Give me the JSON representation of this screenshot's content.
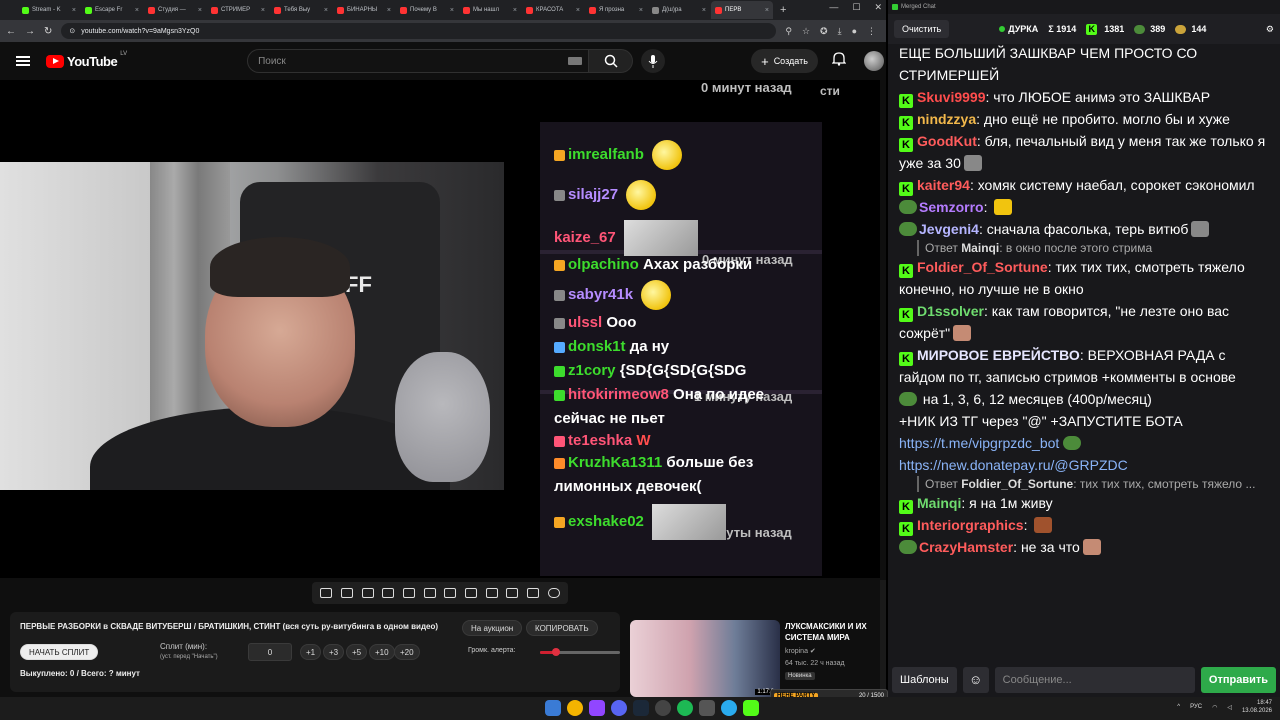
{
  "browser": {
    "tabs": [
      {
        "label": "Stream - K",
        "color": "#53fc18"
      },
      {
        "label": "Escape Fr",
        "color": "#53fc18"
      },
      {
        "label": "Студия —",
        "color": "#ff3333"
      },
      {
        "label": "СТРИМЕР",
        "color": "#ff3333"
      },
      {
        "label": "Тебя Выу",
        "color": "#ff3333"
      },
      {
        "label": "БИНАРНЫ",
        "color": "#ff3333"
      },
      {
        "label": "Почему В",
        "color": "#ff3333"
      },
      {
        "label": "Мы нашл",
        "color": "#ff3333"
      },
      {
        "label": "КРАСОТА",
        "color": "#ff3333"
      },
      {
        "label": "Я прозна",
        "color": "#ff3333"
      },
      {
        "label": "Д(ш)ра",
        "color": "#888888"
      },
      {
        "label": "ПЕРВ",
        "color": "#ff3333",
        "active": true
      }
    ],
    "url": "youtube.com/watch?v=9aMgsn3YzQ0"
  },
  "youtube": {
    "logo_text": "YouTube",
    "country": "LV",
    "search_placeholder": "Поиск",
    "create_label": "Создать"
  },
  "overlay": {
    "top_time": "0 минут назад",
    "top_fragment": "сти",
    "messages": [
      {
        "user": "imrealfanb",
        "text": ""
      },
      {
        "user": "silajj27",
        "text": ""
      },
      {
        "user": "kaize_67",
        "text": ""
      },
      {
        "user": "olpachino",
        "text": "Ахах разборки"
      },
      {
        "user": "sabyr41k",
        "text": ""
      },
      {
        "user": "ulssl",
        "text": "Ооо"
      },
      {
        "user": "donsk1t",
        "text": "да ну"
      },
      {
        "user": "z1cory",
        "text": "{SD{G{SD{G{SDG"
      },
      {
        "user": "hitokirimeow8",
        "text": "Она по идее"
      },
      {
        "user": "",
        "text": "сейчас не пьет"
      },
      {
        "user": "te1eshka",
        "text": "W"
      },
      {
        "user": "KruzhKa1311",
        "text": "больше без"
      },
      {
        "user": "",
        "text": "лимонных девочек("
      },
      {
        "user": "exshake02",
        "text": ""
      }
    ],
    "time_mid": "0 минут назад",
    "time_1m": "1 минуту назад",
    "time_2m": "2 минуты назад",
    "cam_text": "FF"
  },
  "split": {
    "title": "ПЕРВЫЕ РАЗБОРКИ в СКВАДЕ ВИТУБЕРШ / БРАТИШКИН, СТИНТ (вся суть ру-витубинга в одном видео)",
    "auction_label": "На аукцион",
    "copy_label": "КОПИРОВАТЬ",
    "start_label": "НАЧАТЬ СПЛИТ",
    "split_min_label": "Сплит (мин):",
    "split_hint": "(уст. перед \"Начать\")",
    "split_value": "0",
    "increments": [
      "+1",
      "+3",
      "+5",
      "+10",
      "+20"
    ],
    "volume_label": "Громк. алерта:",
    "volume_level": 0.2,
    "stats": "Выкуплено: 0 / Всего: ? минут"
  },
  "recommendation": {
    "title": "ЛУКСМАКСИКИ И ИХ СИСТЕМА МИРА",
    "channel": "kropina",
    "meta": "64 тыс.  22 ч назад",
    "badge": "Новинка",
    "duration": "1:17:2"
  },
  "chat": {
    "window_title": "Merged Chat",
    "clear_label": "Очистить",
    "channel": "ДУРКА",
    "stat_total": "Σ 1914",
    "stat_kick": "1381",
    "stat_twitch": "389",
    "stat_yt": "144",
    "intro": "ЕЩЕ БОЛЬШИЙ ЗАШКВАР ЧЕМ ПРОСТО СО СТРИМЕРШЕЙ",
    "messages": [
      {
        "user": "Skuvi9999",
        "color": "#ff4d4d",
        "text": "что ЛЮБОЕ анимэ это ЗАШКВАР",
        "src": "kick"
      },
      {
        "user": "nindzzya",
        "color": "#f2b84b",
        "text": "дно ещё не пробито. могло бы и хуже",
        "src": "kick"
      },
      {
        "user": "GoodKut",
        "color": "#ff5c5c",
        "text": "бля, печальный вид у меня так же только я уже за 30",
        "src": "kick"
      },
      {
        "user": "kaiter94",
        "color": "#ff5c5c",
        "text": "хомяк систему наебал, сорокет сэкономил",
        "src": "kick"
      },
      {
        "user": "Semzorro",
        "color": "#b57cff",
        "text": "",
        "src": "pepe"
      },
      {
        "user": "Jevgeni4",
        "color": "#b5b5ff",
        "text": "сначала фасолька, терь витюб",
        "src": "pepe"
      },
      {
        "user": "Foldier_Of_Sortune",
        "color": "#ff5c5c",
        "text": "тих тих тих, смотреть тяжело конечно, но лучше не в окно",
        "src": "kick"
      },
      {
        "user": "D1ssolver",
        "color": "#6fdc6f",
        "text": "как там говорится, \"не лезте оно вас сожрёт\"",
        "src": "kick"
      },
      {
        "user": "МИРОВОЕ ЕВРЕЙСТВО",
        "color": "#e6e6ff",
        "text": "ВЕРХОВНАЯ РАДА с гайдом по тг, записью стримов +комменты в основе",
        "src": "kick"
      },
      {
        "user": "Mainqi",
        "color": "#6fdc6f",
        "text": "я на 1м живу",
        "src": "kick"
      },
      {
        "user": "Interiorgraphics",
        "color": "#ff5c5c",
        "text": "",
        "src": "kick"
      },
      {
        "user": "CrazyHamster",
        "color": "#ff5c5c",
        "text": "не за что",
        "src": "pepe"
      }
    ],
    "reply1_prefix": "Ответ",
    "reply1_user": "Mainqi",
    "reply1_text": "в окно после этого стрима",
    "promo_cont1": "на 1, 3, 6, 12 месяцев (400р/месяц)",
    "promo_cont2": "+НИК ИЗ ТГ через \"@\" +ЗАПУСТИТЕ БОТА",
    "promo_link1": "https://t.me/vipgrpzdc_bot",
    "promo_link2": "https://new.donatepay.ru/@GRPZDC",
    "reply2_prefix": "Ответ",
    "reply2_user": "Foldier_Of_Sortune",
    "reply2_text": "тих тих тих, смотреть тяжело ...",
    "templates_label": "Шаблоны",
    "input_placeholder": "Сообщение...",
    "send_label": "Отправить"
  },
  "taskbar": {
    "hype_tag": "HEHE PARTY",
    "hype_progress": "20 / 1500",
    "lang": "РУС",
    "time": "18:47",
    "date": "13.08.2026"
  }
}
